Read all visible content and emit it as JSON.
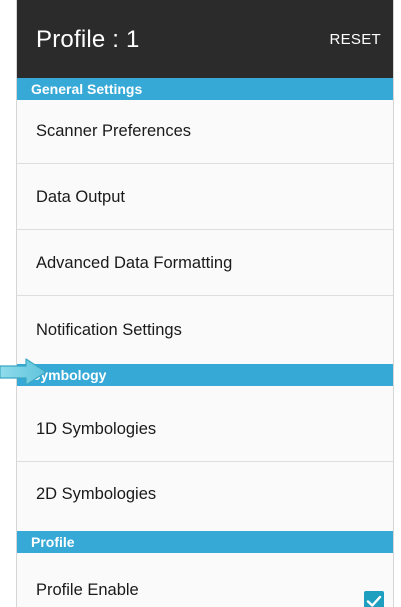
{
  "appbar": {
    "title": "Profile : 1",
    "reset_label": "RESET"
  },
  "sections": {
    "general": "General Settings",
    "symbology": "Symbology",
    "profile": "Profile"
  },
  "general_items": [
    "Scanner Preferences",
    "Data Output",
    "Advanced Data Formatting",
    "Notification Settings"
  ],
  "symbology_items": [
    "1D Symbologies",
    "2D Symbologies"
  ],
  "profile_items": [
    "Profile Enable"
  ],
  "profile_enable_checked": true,
  "colors": {
    "appbar": "#2b2b2b",
    "section_header": "#36a9d6",
    "checkbox": "#1e9fbf",
    "pointer_arrow": "#7ed3e6"
  },
  "icons": {
    "pointer": "arrow-pointer-icon",
    "checkbox": "checkbox-checked-icon"
  }
}
